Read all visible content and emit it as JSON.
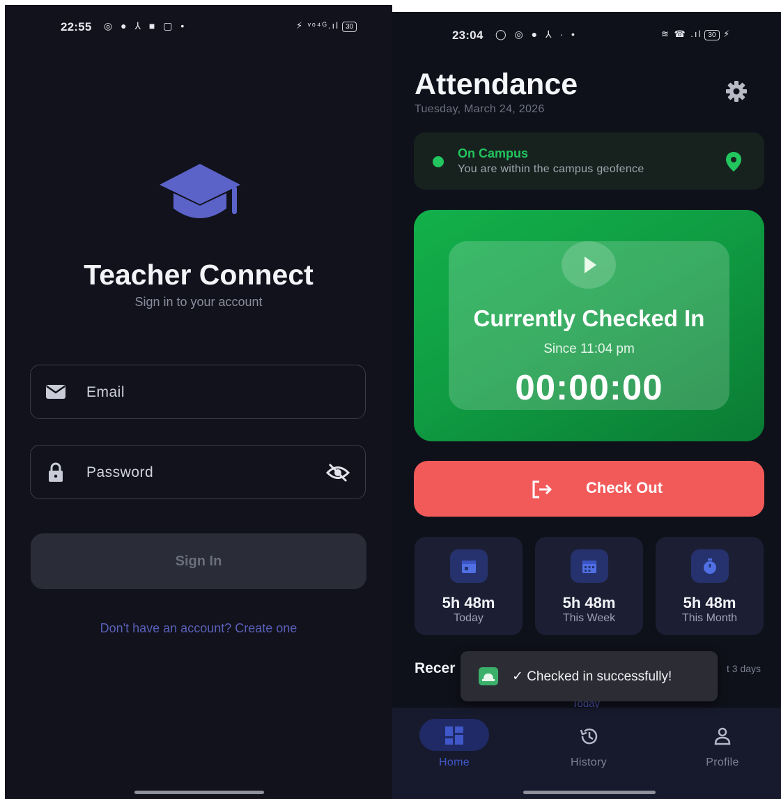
{
  "colors": {
    "accent": "#5b63c9",
    "success": "#22c55e",
    "danger": "#f25a5a",
    "background": "#11121c"
  },
  "login_screen": {
    "status_bar": {
      "time": "22:55",
      "icons": "◎ ● ⅄ ■ ▢ •",
      "signal": "⚡ ᵛᵒ⁴ᴳ.ıl",
      "battery": "30"
    },
    "logo_icon": "graduation-cap-icon",
    "title": "Teacher Connect",
    "subtitle": "Sign in to your account",
    "email": {
      "placeholder": "Email",
      "icon": "mail-icon"
    },
    "password": {
      "placeholder": "Password",
      "icon": "lock-icon",
      "toggle_icon": "eye-off-icon"
    },
    "sign_in_label": "Sign In",
    "create_account_text": "Don't have an account? Create one"
  },
  "attendance_screen": {
    "status_bar": {
      "time": "23:04",
      "icons": "◯ ◎ ● ⅄ · •",
      "signal": "≋ ☎ .ıl",
      "battery": "30"
    },
    "title": "Attendance",
    "date": "Tuesday, March 24, 2026",
    "settings_icon": "gear-icon",
    "campus": {
      "status": "On Campus",
      "description": "You are within the campus geofence",
      "icon": "location-pin-icon"
    },
    "checkin": {
      "title": "Currently Checked In",
      "since": "Since 11:04 pm",
      "timer": "00:00:00",
      "icon": "play-icon"
    },
    "checkout_label": "Check Out",
    "checkout_icon": "logout-icon",
    "stats": [
      {
        "value": "5h 48m",
        "label": "Today",
        "icon": "calendar-today-icon"
      },
      {
        "value": "5h 48m",
        "label": "This Week",
        "icon": "calendar-week-icon"
      },
      {
        "value": "5h 48m",
        "label": "This Month",
        "icon": "timer-icon"
      }
    ],
    "recent": {
      "heading": "Recer",
      "range": "t 3 days",
      "today_peek": "Today"
    },
    "toast": {
      "text": "✓ Checked in successfully!",
      "icon": "app-icon"
    },
    "nav": [
      {
        "label": "Home",
        "icon": "dashboard-icon",
        "active": true
      },
      {
        "label": "History",
        "icon": "history-icon",
        "active": false
      },
      {
        "label": "Profile",
        "icon": "person-icon",
        "active": false
      }
    ]
  }
}
